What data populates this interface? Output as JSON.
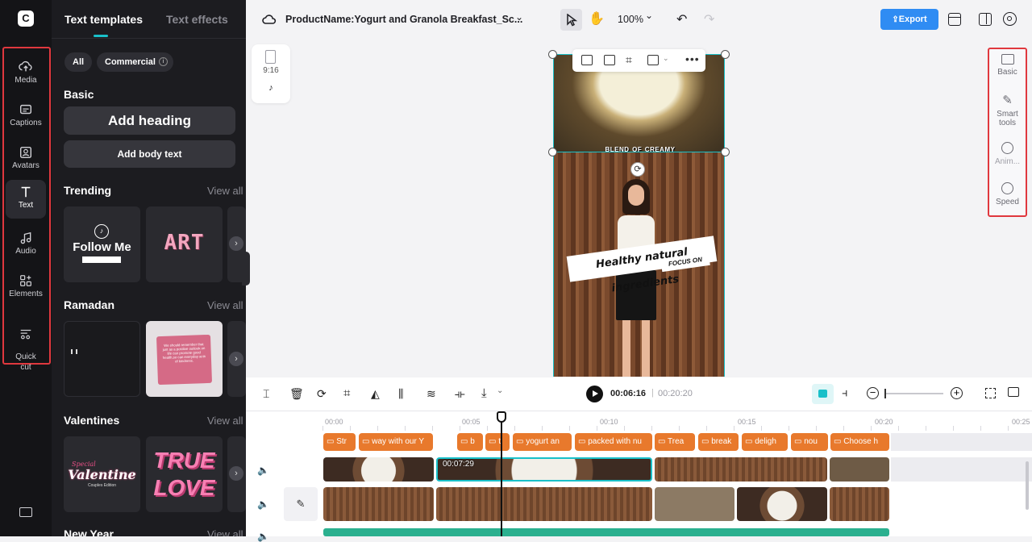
{
  "rail": {
    "items": [
      {
        "label": "Media"
      },
      {
        "label": "Captions"
      },
      {
        "label": "Avatars"
      },
      {
        "label": "Text"
      },
      {
        "label": "Audio"
      },
      {
        "label": "Elements"
      },
      {
        "label": "Quick\ncut"
      }
    ]
  },
  "panel": {
    "tabs": [
      "Text templates",
      "Text effects"
    ],
    "filters": [
      "All",
      "Commercial"
    ],
    "basic": {
      "title": "Basic",
      "add_heading": "Add heading",
      "add_body": "Add body text"
    },
    "sections": [
      {
        "title": "Trending",
        "view_all": "View all",
        "card1": "Follow Me",
        "card2": "ART"
      },
      {
        "title": "Ramadan",
        "view_all": "View all",
        "card2": "We should remember that just as a positive outlook on life can promote good health,so can everyday acts of kindness."
      },
      {
        "title": "Valentines",
        "view_all": "View all",
        "card1a": "Special",
        "card1b": "Valentine",
        "card1c": "Couples Edition",
        "card2a": "TRUE",
        "card2b": "LOVE"
      },
      {
        "title": "New Year",
        "view_all": "View all"
      }
    ]
  },
  "topbar": {
    "project_name": "ProductName:Yogurt and Granola Breakfast_Sc...",
    "zoom": "100%",
    "export": "Export"
  },
  "canvas": {
    "ratio": "9:16",
    "caption_top": "Blend of creamy",
    "overlay_main": "Healthy natural ingredients",
    "overlay_sub": "FOCUS ON"
  },
  "right_tools": [
    "Basic",
    "Smart tools",
    "Anim...",
    "Speed"
  ],
  "timeline": {
    "current_time": "00:06:16",
    "total_time": "00:20:20",
    "ruler": [
      "00:00",
      "00:05",
      "00:10",
      "00:15",
      "00:20",
      "00:25"
    ],
    "clip_time": "00:07:29",
    "text_clips": [
      "Str",
      "way with our Y",
      "b",
      "t",
      "yogurt an",
      "packed with nu",
      "Trea",
      "break",
      "deligh",
      "nou",
      "Choose h"
    ]
  },
  "colors": {
    "accent": "#2f8cf3",
    "highlight": "#e0383e",
    "text_clip": "#e8792c",
    "selection": "#19c0c9"
  }
}
